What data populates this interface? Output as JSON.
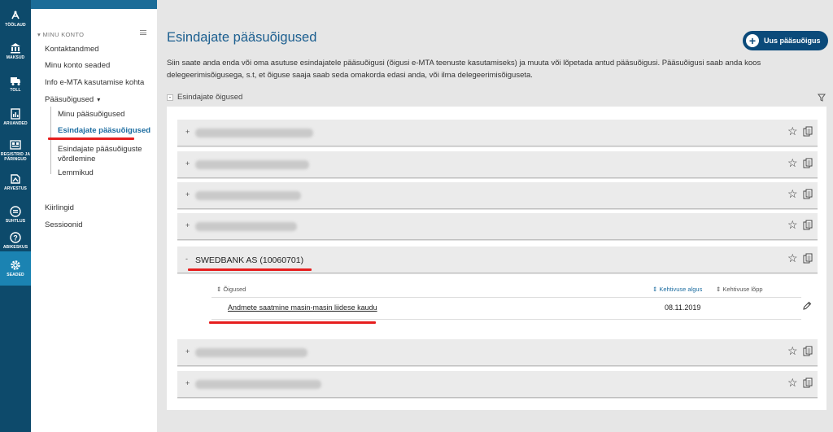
{
  "rail": {
    "items": [
      {
        "label": "TÖÖLAUD",
        "icon": "dashboard-icon"
      },
      {
        "label": "MAKSUD",
        "icon": "bank-icon"
      },
      {
        "label": "TOLL",
        "icon": "truck-icon"
      },
      {
        "label": "ARUANDED",
        "icon": "report-icon"
      },
      {
        "label": "REGISTRID JA PÄRINGUD",
        "icon": "registry-icon"
      },
      {
        "label": "ARVESTUS",
        "icon": "calculator-icon"
      },
      {
        "label": "SUHTLUS",
        "icon": "chat-icon"
      },
      {
        "label": "ABIKESKUS",
        "icon": "help-icon"
      },
      {
        "label": "SEADED",
        "icon": "gear-icon"
      }
    ],
    "active": "SEADED"
  },
  "sidebar": {
    "section": "MINU KONTO",
    "links": [
      "Kontaktandmed",
      "Minu konto seaded",
      "Info e-MTA kasutamise kohta",
      "Pääsuõigused"
    ],
    "sub": [
      "Minu pääsuõigused",
      "Esindajate pääsuõigused",
      "Esindajate pääsuõiguste võrdlemine",
      "Lemmikud"
    ],
    "bottom": [
      "Kiirlingid",
      "Sessioonid"
    ]
  },
  "main": {
    "title": "Esindajate pääsuõigused",
    "new_button": "Uus pääsuõigus",
    "description": "Siin saate anda enda või oma asutuse esindajatele pääsuõigusi (õigusi e-MTA teenuste kasutamiseks) ja muuta või lõpetada antud pääsuõigusi. Pääsuõigusi saab anda koos delegeerimisõigusega, s.t, et õiguse saaja saab seda omakorda edasi anda, või ilma delegeerimisõiguseta.",
    "section_label": "Esindajate õigused",
    "expanded_row": "SWEDBANK AS (10060701)",
    "table": {
      "col_rights": "Õigused",
      "col_start": "Kehtivuse algus",
      "col_end": "Kehtivuse lõpp",
      "row_right": "Andmete saatmine masin-masin liidese kaudu",
      "row_start": "08.11.2019"
    }
  },
  "colors": {
    "rail": "#0d4a6b",
    "rail_active": "#1b83b2",
    "accent": "#1b5e8f",
    "highlight": "#e61e1e"
  }
}
